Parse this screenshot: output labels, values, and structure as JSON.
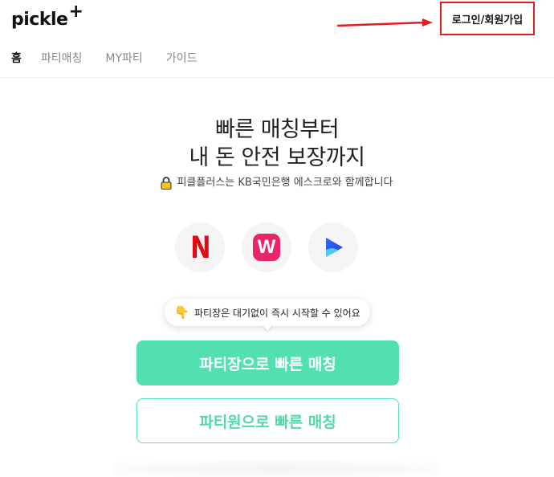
{
  "header": {
    "logo": "pickle",
    "logo_plus": "+",
    "login_label": "로그인/회원가입",
    "annotation_color": "#e02020"
  },
  "nav": {
    "items": [
      {
        "label": "홈",
        "active": true
      },
      {
        "label": "파티매칭",
        "active": false
      },
      {
        "label": "MY파티",
        "active": false
      },
      {
        "label": "가이드",
        "active": false
      }
    ]
  },
  "hero": {
    "headline_line1": "빠른 매칭부터",
    "headline_line2": "내 돈 안전 보장까지",
    "escrow_text": "피클플러스는 KB국민은행 에스크로와 함께합니다"
  },
  "services": [
    {
      "name": "netflix-icon",
      "letter": "N",
      "color": "#e50914"
    },
    {
      "name": "wavve-icon",
      "letter": "W",
      "color": "#e8256a"
    },
    {
      "name": "play-icon",
      "color": "#2f6cf6"
    }
  ],
  "tooltip": {
    "text": "파티장은 대기없이 즉시 시작할 수 있어요"
  },
  "buttons": {
    "leader_label": "파티장으로 빠른 매칭",
    "member_label": "파티원으로 빠른 매칭",
    "accent": "#52e0ae"
  }
}
